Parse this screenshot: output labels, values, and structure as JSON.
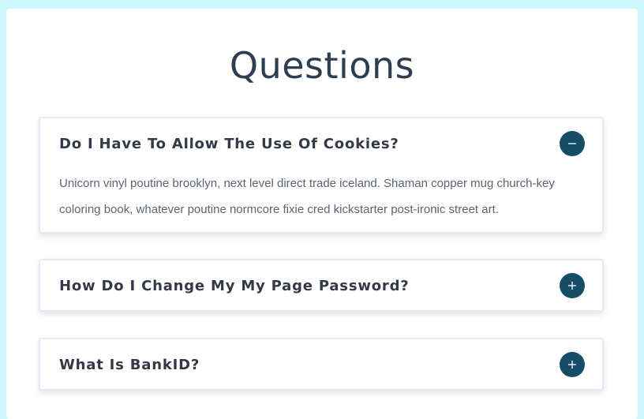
{
  "page": {
    "title": "Questions"
  },
  "faq": {
    "items": [
      {
        "question": "Do I Have To Allow The Use Of Cookies?",
        "answer": "Unicorn vinyl poutine brooklyn, next level direct trade iceland. Shaman copper mug church-key coloring book, whatever poutine normcore fixie cred kickstarter post-ironic street art.",
        "expanded": true,
        "toggle_icon": "minus-icon"
      },
      {
        "question": "How Do I Change My My Page Password?",
        "expanded": false,
        "toggle_icon": "plus-icon"
      },
      {
        "question": "What Is BankID?",
        "expanded": false,
        "toggle_icon": "plus-icon"
      }
    ]
  },
  "colors": {
    "background": "#cdf7fd",
    "card": "#ffffff",
    "title": "#2e3e52",
    "question_text": "#333a46",
    "answer_text": "#5c6571",
    "toggle_button": "#154c66",
    "item_border": "#e6e9f2"
  }
}
